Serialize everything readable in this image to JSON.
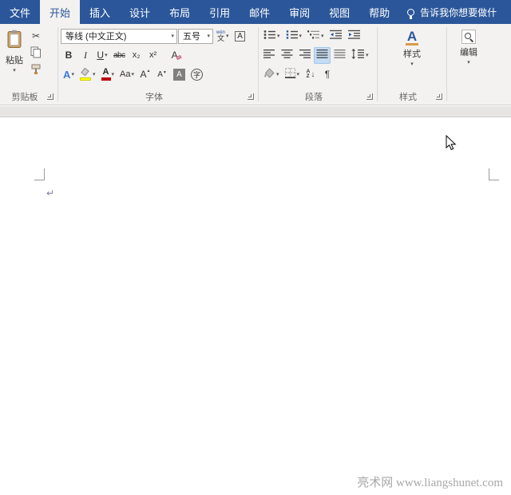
{
  "menu": {
    "tabs": [
      {
        "id": "file",
        "label": "文件"
      },
      {
        "id": "home",
        "label": "开始"
      },
      {
        "id": "insert",
        "label": "插入"
      },
      {
        "id": "design",
        "label": "设计"
      },
      {
        "id": "layout",
        "label": "布局"
      },
      {
        "id": "references",
        "label": "引用"
      },
      {
        "id": "mailings",
        "label": "邮件"
      },
      {
        "id": "review",
        "label": "审阅"
      },
      {
        "id": "view",
        "label": "视图"
      },
      {
        "id": "help",
        "label": "帮助"
      }
    ],
    "tell_me": "告诉我你想要做什"
  },
  "ribbon": {
    "clipboard": {
      "group_label": "剪贴板",
      "paste_label": "粘贴"
    },
    "font": {
      "group_label": "字体",
      "font_name": "等线 (中文正文)",
      "font_size": "五号",
      "bold": "B",
      "italic": "I",
      "underline": "U",
      "strikethrough": "abc",
      "subscript": "x₂",
      "superscript": "x²",
      "clear_formatting": "A",
      "phonetic_top": "wén",
      "phonetic_bottom": "文",
      "char_border": "A",
      "text_effects": "A",
      "font_color": "A",
      "change_case": "Aa",
      "grow_font": "A",
      "shrink_font": "A",
      "char_shading": "A",
      "enclose": "字"
    },
    "paragraph": {
      "group_label": "段落",
      "sort_a": "A",
      "sort_z": "Z",
      "show_marks": "¶"
    },
    "styles": {
      "group_label": "样式",
      "button_label": "样式",
      "big_a": "A"
    },
    "editing": {
      "button_label": "编辑"
    }
  },
  "icons": {
    "cut": "✂"
  },
  "document": {
    "paragraph_mark": "↵"
  },
  "watermark": "亮术网 www.liangshunet.com",
  "colors": {
    "accent": "#2b579a",
    "ribbon_bg": "#f3f2f1",
    "selected_button_bg": "#c5dcf3",
    "highlight_yellow": "#ffff00",
    "font_color_red": "#c00000"
  }
}
